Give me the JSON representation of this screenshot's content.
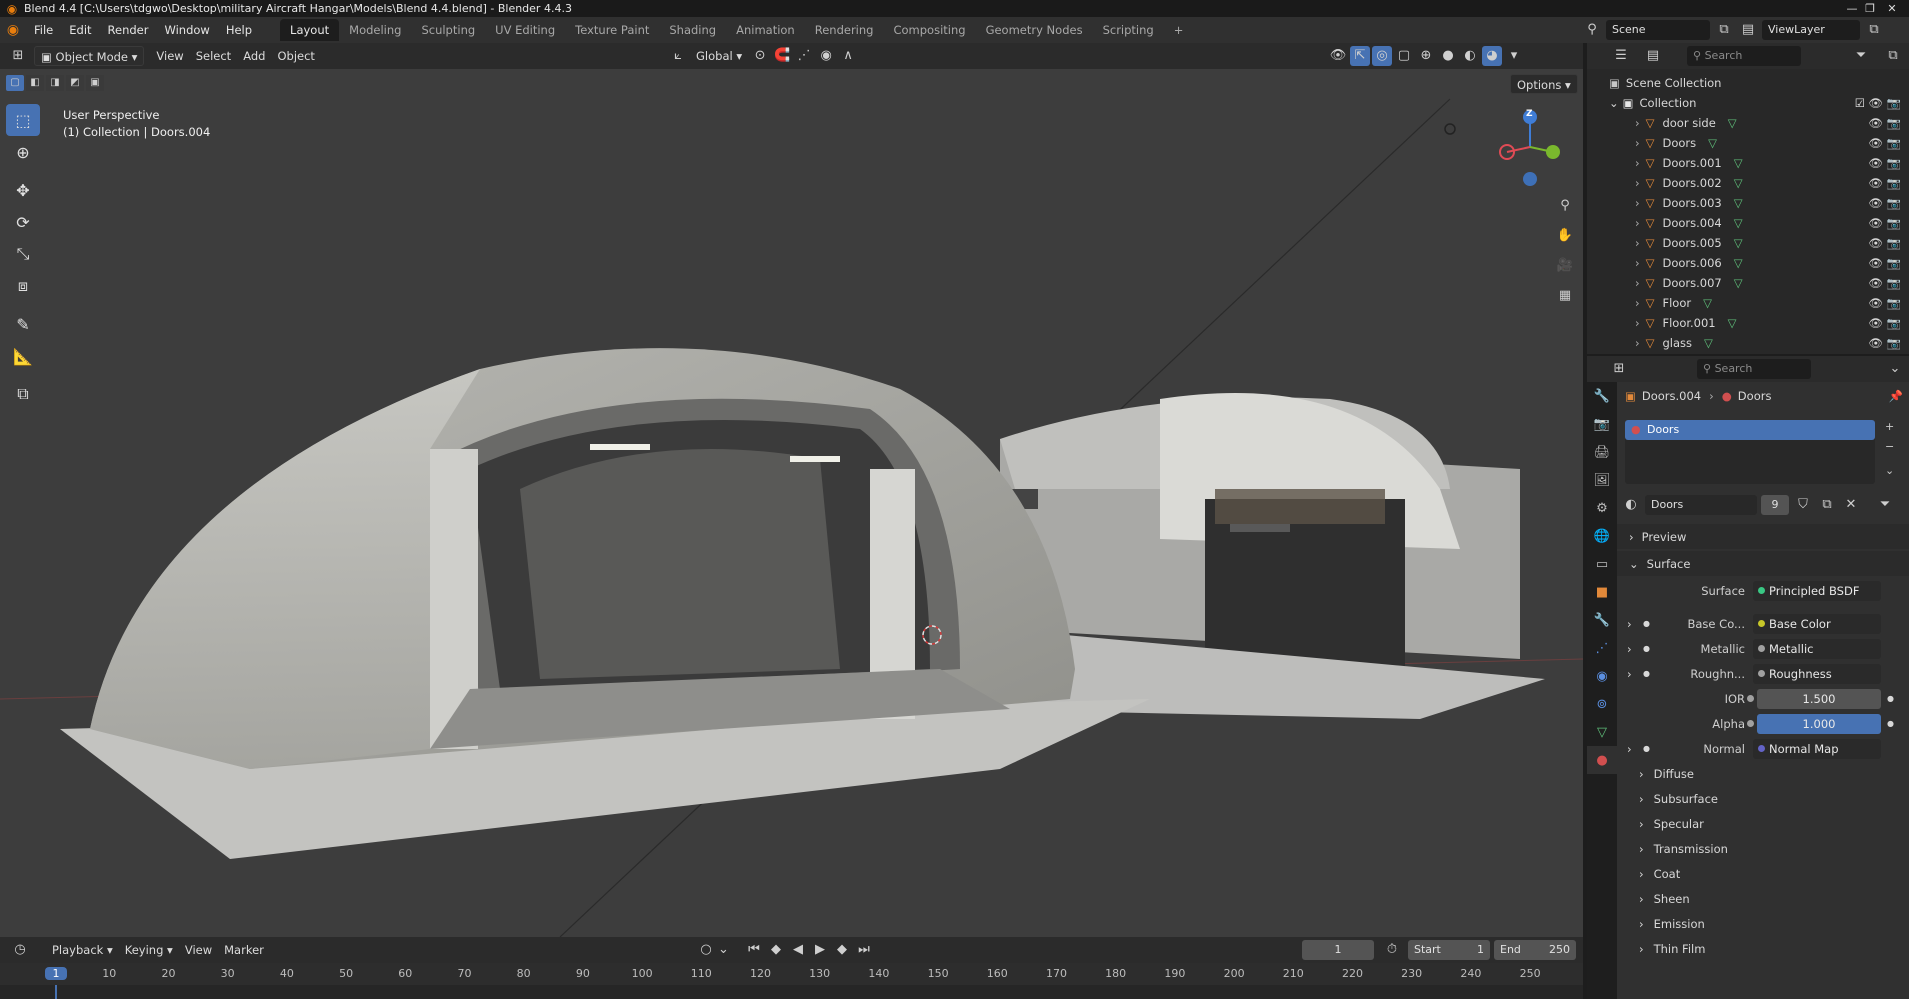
{
  "title_bar": {
    "title": "Blend 4.4 [C:\\Users\\tdgwo\\Desktop\\military Aircraft Hangar\\Models\\Blend 4.4.blend] - Blender 4.4.3",
    "minimize": "—",
    "restore": "❐",
    "close": "✕"
  },
  "menu": [
    "File",
    "Edit",
    "Render",
    "Window",
    "Help"
  ],
  "workspaces": [
    "Layout",
    "Modeling",
    "Sculpting",
    "UV Editing",
    "Texture Paint",
    "Shading",
    "Animation",
    "Rendering",
    "Compositing",
    "Geometry Nodes",
    "Scripting"
  ],
  "add_workspace": "+",
  "scene": {
    "label": "Scene",
    "viewlayer": "ViewLayer"
  },
  "viewport_header": {
    "mode": "Object Mode",
    "menus": [
      "View",
      "Select",
      "Add",
      "Object"
    ],
    "orientation": "Global",
    "options": "Options"
  },
  "viewport": {
    "perspective": "User Perspective",
    "collection_info": "(1) Collection | Doors.004",
    "gizmo_z": "Z"
  },
  "outliner": {
    "search_placeholder": "Search",
    "scene_collection": "Scene Collection",
    "collection": "Collection",
    "items": [
      "door side",
      "Doors",
      "Doors.001",
      "Doors.002",
      "Doors.003",
      "Doors.004",
      "Doors.005",
      "Doors.006",
      "Doors.007",
      "Floor",
      "Floor.001",
      "glass"
    ]
  },
  "properties": {
    "search_placeholder": "Search",
    "breadcrumb_object": "Doors.004",
    "breadcrumb_material": "Doors",
    "slot": "Doors",
    "material_name": "Doors",
    "users": "9",
    "preview": "Preview",
    "surface_section": "Surface",
    "surface_label": "Surface",
    "surface_value": "Principled BSDF",
    "inputs": [
      {
        "label": "Base Co...",
        "value": "Base Color"
      },
      {
        "label": "Metallic",
        "value": "Metallic"
      },
      {
        "label": "Roughn...",
        "value": "Roughness"
      }
    ],
    "ior_label": "IOR",
    "ior": "1.500",
    "alpha_label": "Alpha",
    "alpha": "1.000",
    "normal_label": "Normal",
    "normal_value": "Normal Map",
    "sections": [
      "Diffuse",
      "Subsurface",
      "Specular",
      "Transmission",
      "Coat",
      "Sheen",
      "Emission",
      "Thin Film"
    ]
  },
  "timeline": {
    "menus": [
      "Playback",
      "Keying",
      "View",
      "Marker"
    ],
    "current_frame": "1",
    "start_label": "Start",
    "start": "1",
    "end_label": "End",
    "end": "250",
    "ruler": [
      "1",
      "10",
      "20",
      "30",
      "40",
      "50",
      "60",
      "70",
      "80",
      "90",
      "100",
      "110",
      "120",
      "130",
      "140",
      "150",
      "160",
      "170",
      "180",
      "190",
      "200",
      "210",
      "220",
      "230",
      "240",
      "250"
    ]
  },
  "colors": {
    "accent": "#4772b3",
    "object_orange": "#e2893a",
    "mesh_green": "#5fbf7a",
    "axis_x": "#e04b55",
    "axis_y": "#7ab82d",
    "axis_z": "#3f7dd6",
    "socket_yellow": "#c7c729",
    "socket_gray": "#a1a1a1",
    "socket_purple": "#6363c7",
    "shader_green": "#39c884"
  },
  "icons": [
    "blender-logo-icon",
    "editor-type-icon",
    "object-mode-icon",
    "orientation-icon",
    "snap-icon",
    "proportional-icon",
    "visibility-icon",
    "gizmo-icon",
    "overlay-icon",
    "shading-wire-icon",
    "shading-solid-icon",
    "shading-material-icon",
    "shading-rendered-icon",
    "select-box-icon",
    "cursor-icon",
    "move-icon",
    "rotate-icon",
    "scale-icon",
    "transform-icon",
    "annotate-icon",
    "measure-icon",
    "add-cube-icon",
    "zoom-icon",
    "hand-icon",
    "camera-icon",
    "grid-icon",
    "eye-icon",
    "camera-render-icon",
    "filter-icon",
    "pin-icon",
    "play-icon",
    "jump-start-icon",
    "jump-end-icon"
  ]
}
